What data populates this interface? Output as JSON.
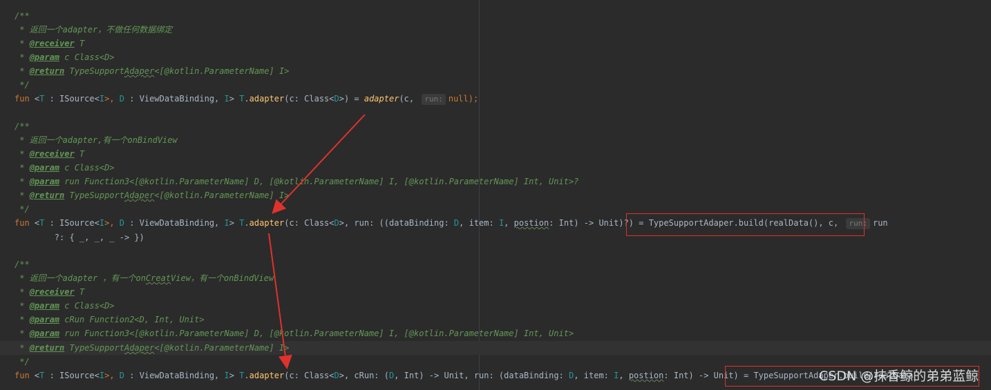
{
  "block1": {
    "l1": "/**",
    "l2": " * 返回一个adapter，不做任何数据绑定",
    "l3_pre": " * ",
    "l3_tag": "@receiver",
    "l3_post": " T",
    "l4_pre": " * ",
    "l4_tag": "@param",
    "l4_post": " c Class<D>",
    "l5_pre": " * ",
    "l5_tag": "@return",
    "l5_a": " TypeSupport",
    "l5_typo": "Adaper",
    "l5_b": "<[@kotlin.ParameterName] I>",
    "l6": " */",
    "sig": {
      "fun": "fun ",
      "lt": "<",
      "T": "T",
      "isrc": " : ISource<",
      "I1": "I",
      "gtc": ">, ",
      "D": "D",
      "vdb": " : ViewDataBinding, ",
      "I2": "I",
      "gt": "> ",
      "recv": "T",
      "dot": ".",
      "name": "adapter",
      "params": "(c: Class<",
      "D2": "D",
      "pend": ">) = ",
      "call": "adapter",
      "args": "(c, ",
      "hint": "run:",
      "nul": "null",
      "semi": ");"
    }
  },
  "block2": {
    "l1": "/**",
    "l2": " * 返回一个adapter,有一个onBindView",
    "l3_pre": " * ",
    "l3_tag": "@receiver",
    "l3_post": " T",
    "l4_pre": " * ",
    "l4_tag": "@param",
    "l4_post": " c Class<D>",
    "l5_pre": " * ",
    "l5_tag": "@param",
    "l5_post": " run Function3<[@kotlin.ParameterName] D, [@kotlin.ParameterName] I, [@kotlin.ParameterName] Int, Unit>?",
    "l6_pre": " * ",
    "l6_tag": "@return",
    "l6_a": " TypeSupport",
    "l6_typo": "Adaper",
    "l6_b": "<[@kotlin.ParameterName] I>",
    "l7": " */",
    "sig": {
      "fun": "fun ",
      "lt": "<",
      "T": "T",
      "isrc": " : ISource<",
      "I1": "I",
      "gtc": ">, ",
      "D": "D",
      "vdb": " : ViewDataBinding, ",
      "I2": "I",
      "gt": "> ",
      "recv": "T",
      "dot": ".",
      "name": "adapter",
      "p1": "(c: Class<",
      "D2": "D",
      "p2": ">, run: ((dataBinding: ",
      "D3": "D",
      "p3": ", item: ",
      "I3": "I",
      "p4": ", ",
      "postion": "postion",
      "p5": ": Int) -> Unit)?) = ",
      "body": "TypeSupportAdaper.build(realData(), c, ",
      "hint": "run:",
      "run": "run"
    },
    "cont": "        ?: { _, _, _ -> })"
  },
  "block3": {
    "l1": "/**",
    "l2_a": " * 返回一个adapter ，有一个on",
    "l2_typo": "Creat",
    "l2_b": "View，有一个onBindView",
    "l3_pre": " * ",
    "l3_tag": "@receiver",
    "l3_post": " T",
    "l4_pre": " * ",
    "l4_tag": "@param",
    "l4_post": " c Class<D>",
    "l5_pre": " * ",
    "l5_tag": "@param",
    "l5_post": " cRun Function2<D, Int, Unit>",
    "l6_pre": " * ",
    "l6_tag": "@param",
    "l6_post": " run Function3<[@kotlin.ParameterName] D, [@kotlin.ParameterName] I, [@kotlin.ParameterName] Int, Unit>",
    "l7_pre": " * ",
    "l7_tag": "@return",
    "l7_a": " TypeSupport",
    "l7_typo": "Adaper",
    "l7_b": "<[@kotlin.ParameterName] I>",
    "l8": " */",
    "sig": {
      "fun": "fun ",
      "lt": "<",
      "T": "T",
      "isrc": " : ISource<",
      "I1": "I",
      "gtc": ">, ",
      "D": "D",
      "vdb": " : ViewDataBinding, ",
      "I2": "I",
      "gt": "> ",
      "recv": "T",
      "dot": ".",
      "name": "adapter",
      "p1": "(c: Class<",
      "D2": "D",
      "p2": ">, cRun: (",
      "D3": "D",
      "p3": ", Int) -> Unit, run: (dataBinding: ",
      "D4": "D",
      "p4": ", item: ",
      "I3": "I",
      "p5": ", ",
      "postion": "postion",
      "p6": ": Int) -> Unit) = ",
      "body": "TypeSupportAdaper.build(realData"
    }
  },
  "watermark": "CSDN @抹香鲸的弟弟蓝鲸",
  "colors": {
    "annotation_red": "#e0322c",
    "background": "#2b2b2b"
  }
}
